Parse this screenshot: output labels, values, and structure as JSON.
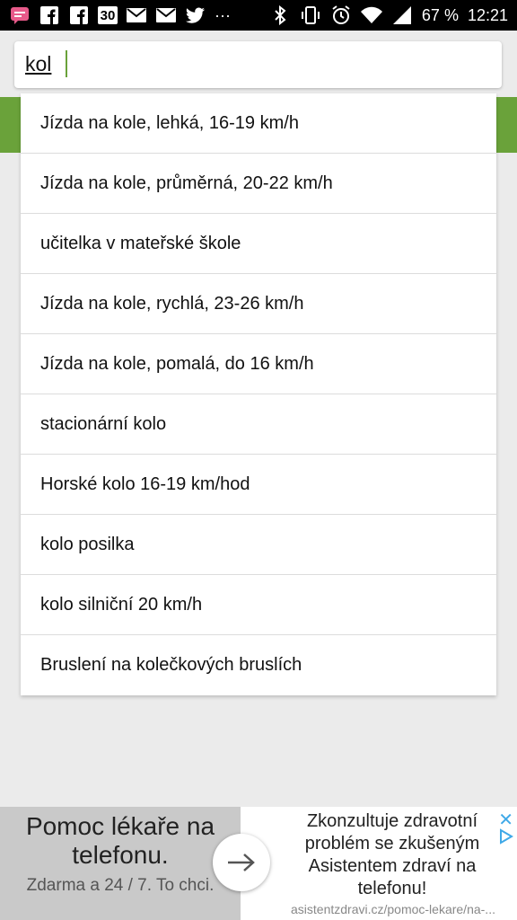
{
  "status_bar": {
    "icons_left": [
      "message-icon",
      "facebook-icon",
      "facebook-icon",
      "calendar-icon",
      "gmail-icon",
      "gmail-icon",
      "twitter-icon",
      "more-icon"
    ],
    "calendar_day": "30",
    "more": "···",
    "battery": "67 %",
    "time": "12:21",
    "colors": {
      "background": "#000000",
      "accent": "#6aa23a"
    }
  },
  "search": {
    "value": "kol"
  },
  "suggestions": [
    "Jízda na kole, lehká, 16-19 km/h",
    "Jízda na kole, průměrná, 20-22 km/h",
    "učitelka v mateřské škole",
    "Jízda na kole, rychlá, 23-26 km/h",
    "Jízda na kole, pomalá, do 16 km/h",
    "stacionární kolo",
    "Horské kolo 16-19 km/hod",
    "kolo posilka",
    "kolo silniční 20 km/h",
    "Bruslení na kolečkových bruslích"
  ],
  "ad": {
    "headline": "Pomoc lékaře na telefonu.",
    "subline": "Zdarma a 24 / 7. To chci.",
    "description": "Zkonzultuje zdravotní problém se zkušeným Asistentem zdraví na telefonu!",
    "url": "asistentzdravi.cz/pomoc-lekare/na-...",
    "close": "✕"
  }
}
